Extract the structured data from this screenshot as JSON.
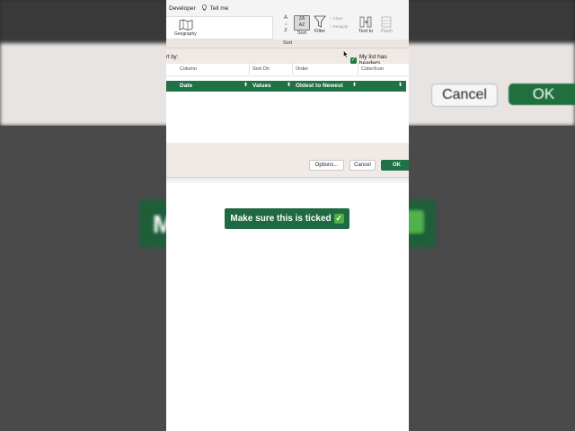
{
  "background": {
    "cancel_label": "Cancel",
    "ok_label": "OK",
    "caption_initial": "M"
  },
  "ribbon": {
    "tabs": [
      "Developer",
      "Tell me"
    ],
    "geography_label": "Geography",
    "sort_label": "Sort",
    "filter_label": "Filter",
    "az_label": "Z",
    "clear_label": "Clear",
    "reapply_label": "Reapply",
    "text_to_label": "Text to",
    "flash_label": "Flash"
  },
  "dialog": {
    "title": "Sort",
    "sort_by_label": "rt by:",
    "my_list_has_headers": "My list has headers",
    "headers_checked": true,
    "columns": [
      "Column",
      "Sort On",
      "Order",
      "Color/Icon"
    ],
    "row": {
      "column": "Date",
      "sort_on": "Values",
      "order": "Oldest to Newest",
      "color_icon": ""
    },
    "buttons": {
      "options": "Options...",
      "cancel": "Cancel",
      "ok": "OK"
    }
  },
  "caption": {
    "text": "Make sure this is ticked",
    "emoji": "✓"
  },
  "colors": {
    "excel_green": "#1e7245",
    "dialog_bg": "#f0e9e5"
  }
}
